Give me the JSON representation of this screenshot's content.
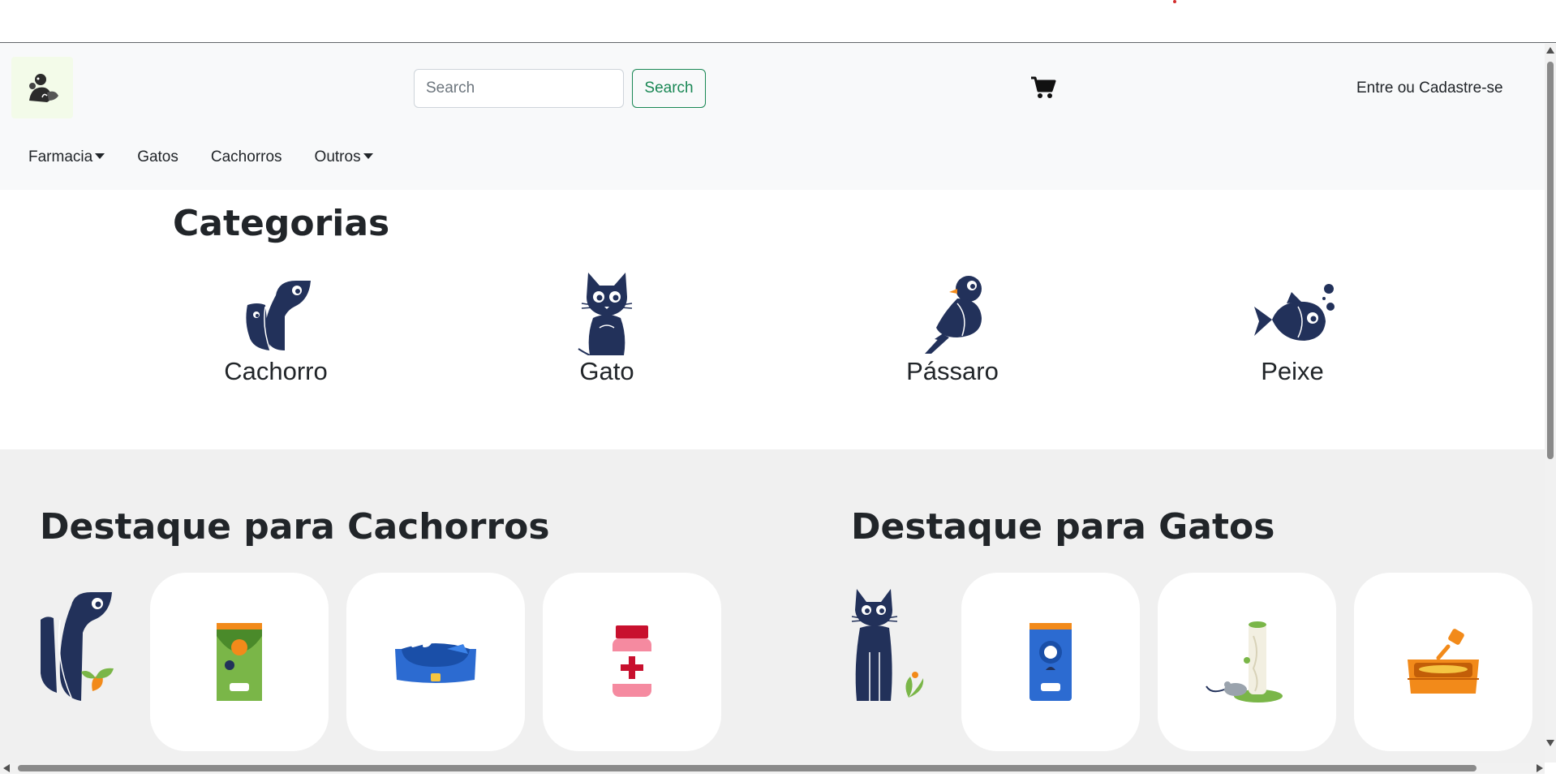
{
  "header": {
    "logo_icon": "pet-shop-logo-icon",
    "search": {
      "placeholder": "Search",
      "value": ""
    },
    "search_button_label": "Search",
    "cart_icon": "shopping-cart-icon",
    "login_label": "Entre ou Cadastre-se"
  },
  "nav": {
    "items": [
      {
        "label": "Farmacia",
        "dropdown": true
      },
      {
        "label": "Gatos",
        "dropdown": false
      },
      {
        "label": "Cachorros",
        "dropdown": false
      },
      {
        "label": "Outros",
        "dropdown": true
      }
    ]
  },
  "categories": {
    "title": "Categorias",
    "items": [
      {
        "label": "Cachorro",
        "icon": "dog-icon"
      },
      {
        "label": "Gato",
        "icon": "cat-icon"
      },
      {
        "label": "Pássaro",
        "icon": "bird-icon"
      },
      {
        "label": "Peixe",
        "icon": "fish-icon"
      }
    ]
  },
  "featured_dogs": {
    "title": "Destaque para Cachorros",
    "products": [
      {
        "icon": "dog-food-bag-icon"
      },
      {
        "icon": "dog-bed-icon"
      },
      {
        "icon": "medicine-bottle-icon"
      }
    ]
  },
  "featured_cats": {
    "title": "Destaque para Gatos",
    "products": [
      {
        "icon": "cat-food-bag-icon"
      },
      {
        "icon": "scratching-post-icon"
      },
      {
        "icon": "litter-box-icon"
      }
    ]
  },
  "colors": {
    "navy": "#22315a",
    "green_accent": "#198754",
    "orange": "#f28a1a",
    "light_green": "#7ab648"
  }
}
